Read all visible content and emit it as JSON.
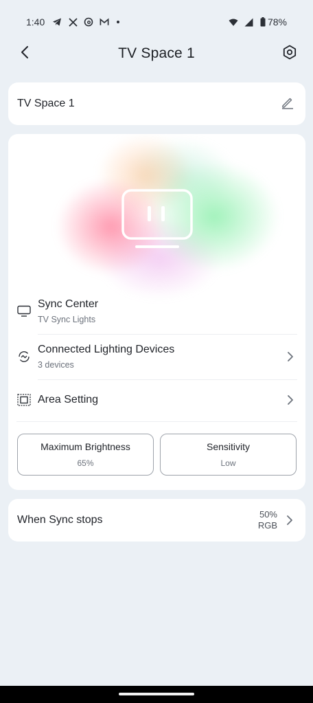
{
  "status_bar": {
    "time": "1:40",
    "battery": "78%",
    "icons_left": [
      "telegram-icon",
      "x-icon",
      "threads-icon",
      "gmail-icon",
      "dot-icon"
    ],
    "icons_right": [
      "wifi-icon",
      "signal-icon",
      "battery-icon"
    ]
  },
  "header": {
    "title": "TV Space 1",
    "back_icon": "chevron-left-icon",
    "settings_icon": "gear-icon"
  },
  "name_card": {
    "name": "TV Space 1",
    "edit_icon": "pencil-icon"
  },
  "sync_center": {
    "title": "Sync Center",
    "subtitle": "TV Sync Lights",
    "icon": "tv-icon"
  },
  "connected_devices": {
    "title": "Connected Lighting Devices",
    "subtitle": "3 devices",
    "icon": "link-cycle-icon"
  },
  "area_setting": {
    "title": "Area Setting",
    "icon": "area-frame-icon"
  },
  "brightness": {
    "title": "Maximum Brightness",
    "value": "65%"
  },
  "sensitivity": {
    "title": "Sensitivity",
    "value": "Low"
  },
  "sync_stops": {
    "title": "When Sync stops",
    "value_brightness": "50%",
    "value_mode": "RGB"
  },
  "colors": {
    "background": "#ebf0f5",
    "card": "#ffffff",
    "text": "#1e2127",
    "subtext": "#6b717b"
  }
}
